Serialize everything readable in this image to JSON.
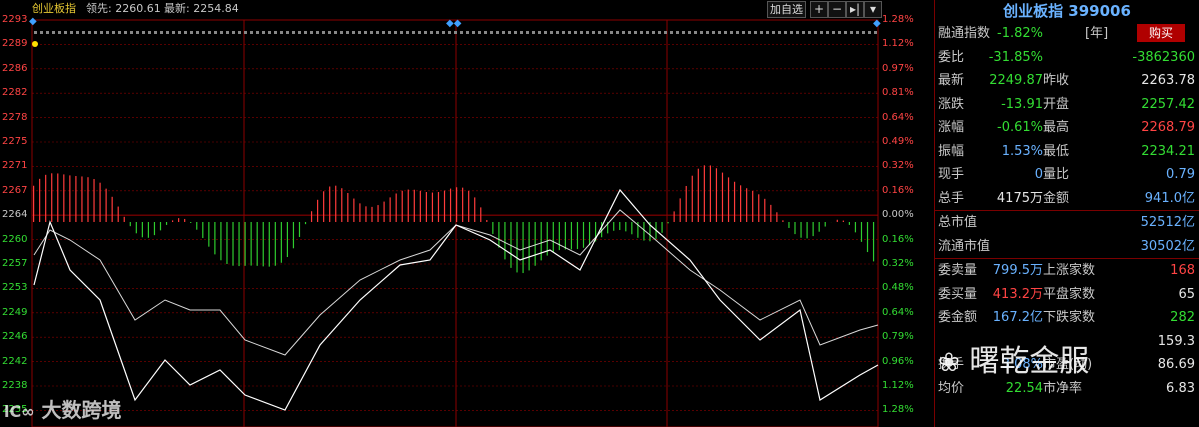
{
  "toolbar": {
    "title": "创业板指",
    "lead_label": "领先:",
    "lead_value": "2260.61",
    "latest_label": "最新:",
    "latest_value": "2254.84",
    "add_label": "加自选",
    "btn_plus": "+",
    "btn_minus": "−",
    "btn_next": "▸|",
    "btn_menu": "▾"
  },
  "axes": {
    "left": [
      "2293",
      "2289",
      "2286",
      "2282",
      "2278",
      "2275",
      "2271",
      "2267",
      "2264",
      "2260",
      "2257",
      "2253",
      "2249",
      "2246",
      "2242",
      "2238",
      "2235"
    ],
    "right": [
      "1.28%",
      "1.12%",
      "0.97%",
      "0.81%",
      "0.64%",
      "0.49%",
      "0.32%",
      "0.16%",
      "0.00%",
      "0.16%",
      "0.32%",
      "0.48%",
      "0.64%",
      "0.79%",
      "0.96%",
      "1.12%",
      "1.28%"
    ]
  },
  "panel": {
    "title": "创业板指 399006",
    "buy_label": "购买",
    "rows": [
      {
        "l1": "融通指数",
        "v1": "-1.82%",
        "v1c": "green",
        "l2": "",
        "v2": "",
        "v2c": "white",
        "note": "[年]"
      },
      {
        "l1": "委比",
        "v1": "-31.85%",
        "v1c": "green",
        "l2": "",
        "v2": "-3862360",
        "v2c": "green"
      },
      {
        "l1": "最新",
        "v1": "2249.87",
        "v1c": "green",
        "l2": "昨收",
        "v2": "2263.78",
        "v2c": "white"
      },
      {
        "l1": "涨跌",
        "v1": "-13.91",
        "v1c": "green",
        "l2": "开盘",
        "v2": "2257.42",
        "v2c": "green"
      },
      {
        "l1": "涨幅",
        "v1": "-0.61%",
        "v1c": "green",
        "l2": "最高",
        "v2": "2268.79",
        "v2c": "red"
      },
      {
        "l1": "振幅",
        "v1": "1.53%",
        "v1c": "cyan",
        "l2": "最低",
        "v2": "2234.21",
        "v2c": "green"
      },
      {
        "l1": "现手",
        "v1": "0",
        "v1c": "cyan",
        "l2": "量比",
        "v2": "0.79",
        "v2c": "cyan"
      },
      {
        "l1": "总手",
        "v1": "4175万",
        "v1c": "white",
        "l2": "金额",
        "v2": "941.0亿",
        "v2c": "cyan"
      },
      {
        "l1": "总市值",
        "v1": "",
        "v1c": "white",
        "l2": "",
        "v2": "52512亿",
        "v2c": "cyan"
      },
      {
        "l1": "流通市值",
        "v1": "",
        "v1c": "white",
        "l2": "",
        "v2": "30502亿",
        "v2c": "cyan"
      },
      {
        "l1": "委卖量",
        "v1": "799.5万",
        "v1c": "cyan",
        "l2": "上涨家数",
        "v2": "168",
        "v2c": "red"
      },
      {
        "l1": "委买量",
        "v1": "413.2万",
        "v1c": "red",
        "l2": "平盘家数",
        "v2": "65",
        "v2c": "white"
      },
      {
        "l1": "委金额",
        "v1": "167.2亿",
        "v1c": "cyan",
        "l2": "下跌家数",
        "v2": "282",
        "v2c": "green"
      },
      {
        "l1": "",
        "v1": "",
        "v1c": "white",
        "l2": "",
        "v2": "159.3",
        "v2c": "white"
      },
      {
        "l1": "换手",
        "v1": "3.08%",
        "v1c": "cyan",
        "l2": "市盈(动)",
        "v2": "86.69",
        "v2c": "white"
      },
      {
        "l1": "均价",
        "v1": "22.54",
        "v1c": "green",
        "l2": "市净率",
        "v2": "6.83",
        "v2c": "white"
      }
    ]
  },
  "watermarks": {
    "left": "大数跨境",
    "right": "曙乾金服"
  },
  "colors": {
    "grid": "#8b0000",
    "up_bar": "#ff3b3b",
    "down_bar": "#2ecc2e",
    "price_line": "#ffffff",
    "avg_line": "#ffffff",
    "up_text": "#ff4444",
    "down_text": "#33dd33"
  }
}
